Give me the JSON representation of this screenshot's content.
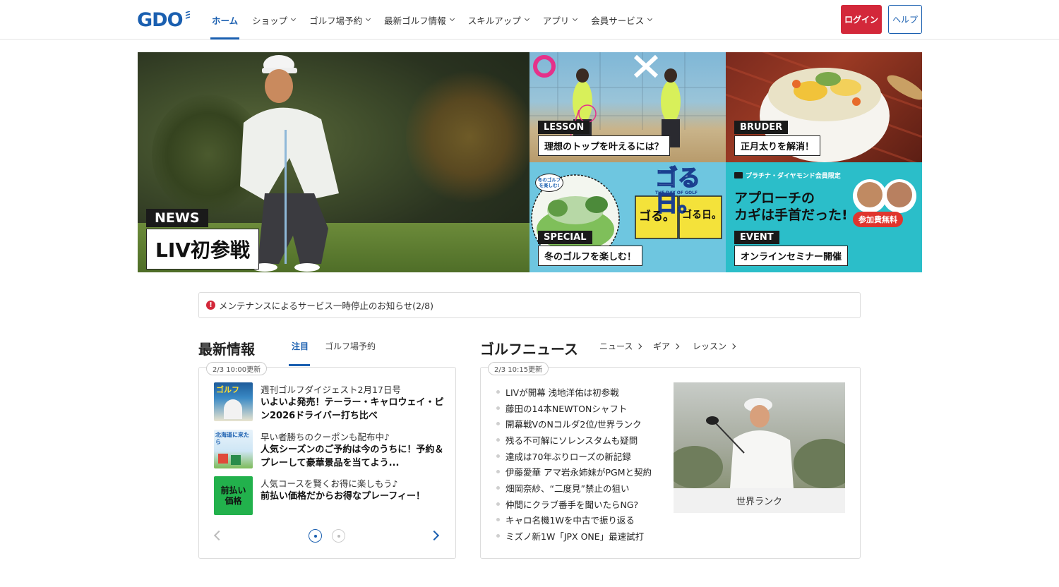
{
  "header": {
    "logo": "GDO",
    "nav": [
      {
        "label": "ホーム",
        "active": true
      },
      {
        "label": "ショップ"
      },
      {
        "label": "ゴルフ場予約"
      },
      {
        "label": "最新ゴルフ情報"
      },
      {
        "label": "スキルアップ"
      },
      {
        "label": "アプリ"
      },
      {
        "label": "会員サービス"
      }
    ],
    "login": "ログイン",
    "help": "ヘルプ"
  },
  "hero": {
    "main": {
      "badge": "NEWS",
      "caption": "LIV初参戦"
    },
    "lesson": {
      "badge": "LESSON",
      "caption": "理想のトップを叶えるには？",
      "ok_mark": "○",
      "ng_mark": "×"
    },
    "bruder": {
      "badge": "BRUDER",
      "caption": "正月太りを解消！"
    },
    "special": {
      "badge": "SPECIAL",
      "caption": "冬のゴルフを楽しむ！",
      "art_title": "ゴる日。",
      "art_sub": "THE DAY OF GOLF",
      "art_bubble": "冬のゴルフを楽しむ!",
      "art_card1": "ゴる。",
      "art_card2": "ゴる日。"
    },
    "event": {
      "badge": "EVENT",
      "caption": "オンラインセミナー開催",
      "top_label": "プラチナ・ダイヤモンド会員限定",
      "headline1": "アプローチの",
      "headline2": "カギは手首だった!",
      "free_label": "参加費無料"
    }
  },
  "notice": {
    "text": "メンテナンスによるサービス一時停止のお知らせ(2/8)"
  },
  "latest": {
    "title": "最新情報",
    "tabs": [
      "注目",
      "ゴルフ場予約"
    ],
    "updated": "2/3 10:00更新",
    "items": [
      {
        "sub": "週刊ゴルフダイジェスト2月17日号",
        "main": "いよいよ発売！テーラー・キャロウェイ・ピン2026ドライバー打ち比べ"
      },
      {
        "sub": "早い者勝ちのクーポンも配布中♪",
        "main": "人気シーズンのご予約は今のうちに！予約＆プレーして豪華景品を当てよう..."
      },
      {
        "sub": "人気コースを賢くお得に楽しもう♪",
        "main": "前払い価格だからお得なプレーフィー！"
      }
    ],
    "thumb_texts": [
      "ゴルフ",
      "北海道に来たら",
      "前払い価格"
    ]
  },
  "news": {
    "title": "ゴルフニュース",
    "categories": [
      "ニュース",
      "ギア",
      "レッスン"
    ],
    "updated": "2/3 10:15更新",
    "items": [
      "LIVが開幕 浅地洋佑は初参戦",
      "藤田の14本NEWTONシャフト",
      "開幕戦VのNコルダ2位/世界ランク",
      "残る不可解にソレンスタムも疑問",
      "達成は70年ぶりローズの新記録",
      "伊藤愛華 アマ岩永姉妹がPGMと契約",
      "畑岡奈紗、“二度見”禁止の狙い",
      "仲間にクラブ番手を聞いたらNG?",
      "キャロ名機1Wを中古で振り返る",
      "ミズノ新1W「JPX ONE」最速試打"
    ],
    "photo_caption": "世界ランク"
  },
  "colors": {
    "brand": "#1a5fb0",
    "login": "#d3283a"
  }
}
